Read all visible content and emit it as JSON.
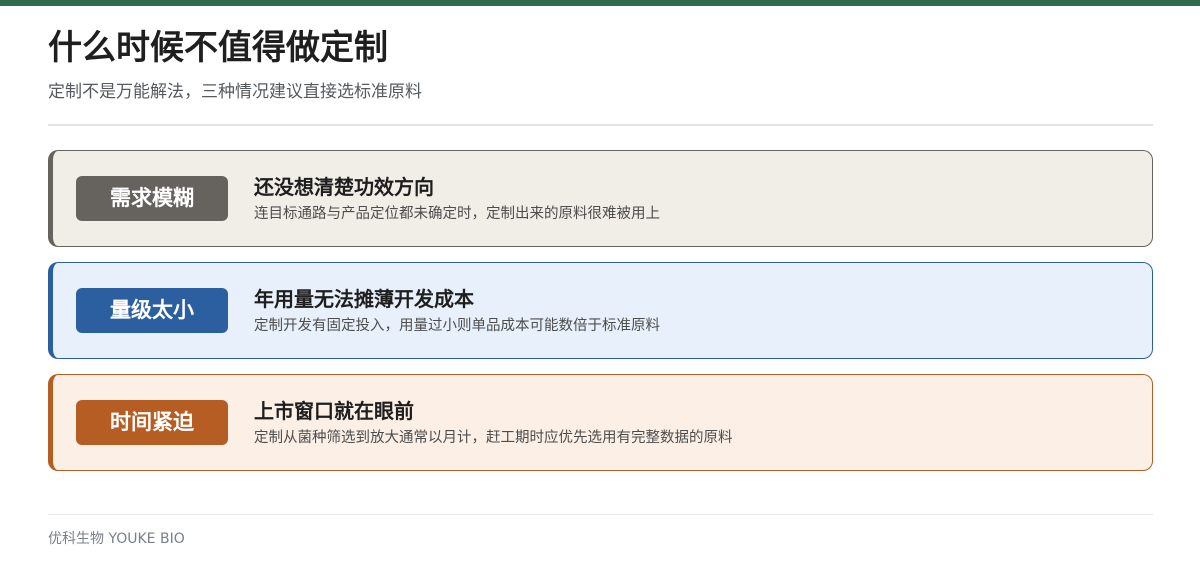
{
  "accent_color": "#2e6b4f",
  "header": {
    "title": "什么时候不值得做定制",
    "subtitle": "定制不是万能解法，三种情况建议直接选标准原料"
  },
  "cards": [
    {
      "badge": "需求模糊",
      "title": "还没想清楚功效方向",
      "desc": "连目标通路与产品定位都未确定时，定制出来的原料很难被用上",
      "color": "#66635f",
      "background": "#f1eee8"
    },
    {
      "badge": "量级太小",
      "title": "年用量无法摊薄开发成本",
      "desc": "定制开发有固定投入，用量过小则单品成本可能数倍于标准原料",
      "color": "#2c5fa0",
      "background": "#e8f0fb"
    },
    {
      "badge": "时间紧迫",
      "title": "上市窗口就在眼前",
      "desc": "定制从菌种筛选到放大通常以月计，赶工期时应优先选用有完整数据的原料",
      "color": "#b55d22",
      "background": "#fbefe6"
    }
  ],
  "footer": {
    "brand": "优科生物 YOUKE BIO"
  }
}
